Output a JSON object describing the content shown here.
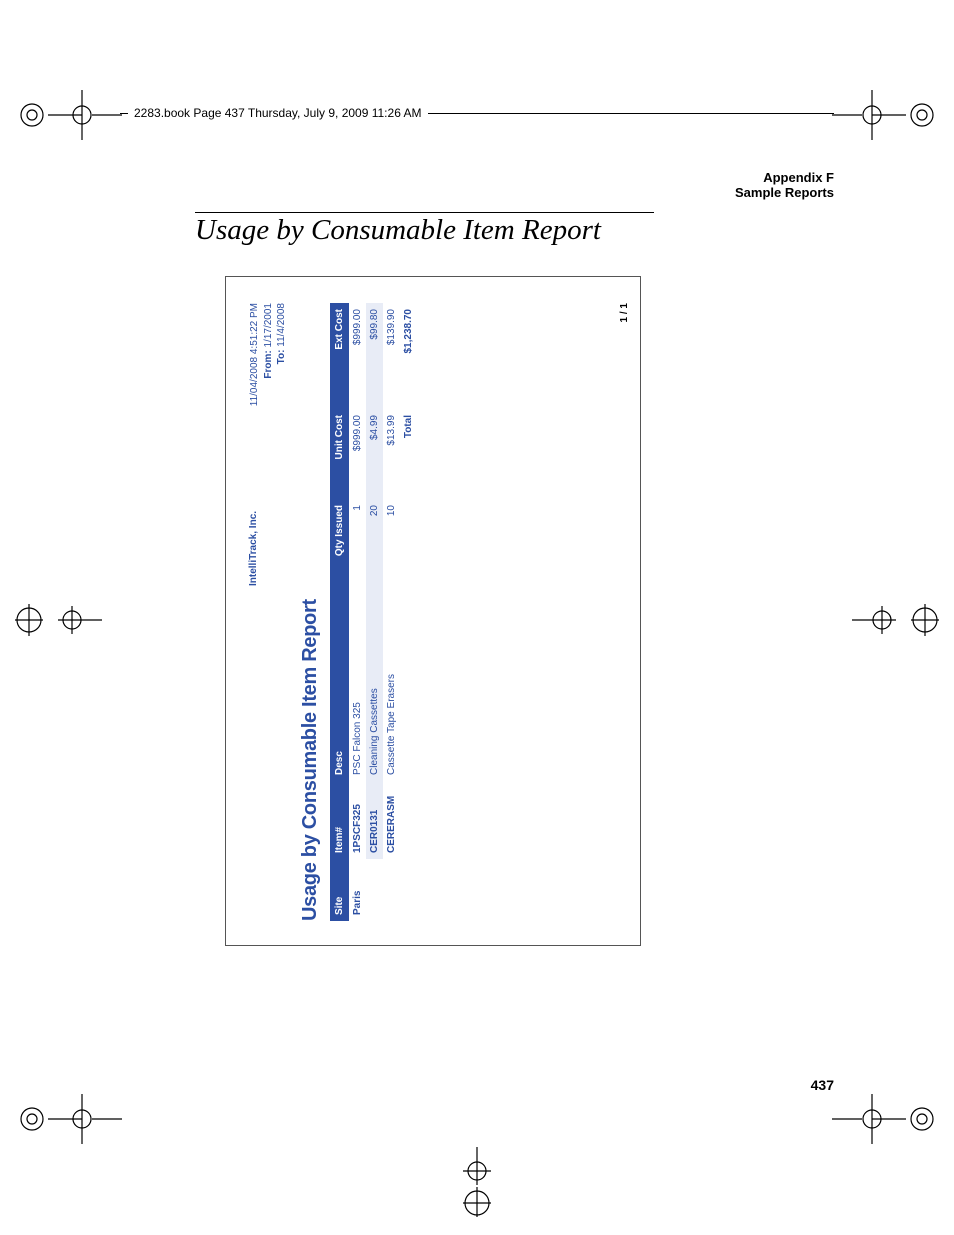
{
  "book_header": "2283.book  Page 437  Thursday, July 9, 2009  11:26 AM",
  "appendix": {
    "line1": "Appendix F",
    "line2": "Sample Reports"
  },
  "section_title": "Usage by Consumable Item Report",
  "page_number": "437",
  "report": {
    "company": "IntelliTrack, Inc.",
    "timestamp": "11/04/2008 4:51:22 PM",
    "from_label": "From:",
    "from_value": "1/17/2001",
    "to_label": "To:",
    "to_value": "11/4/2008",
    "title": "Usage by Consumable Item Report",
    "columns": {
      "site": "Site",
      "item": "Item#",
      "desc": "Desc",
      "qty": "Qty Issued",
      "unit": "Unit Cost",
      "ext": "Ext Cost"
    },
    "site": "Paris",
    "rows": [
      {
        "item": "1PSCF325",
        "desc": "PSC Falcon 325",
        "qty": "1",
        "unit": "$999.00",
        "ext": "$999.00"
      },
      {
        "item": "CER0131",
        "desc": "Cleaning Cassettes",
        "qty": "20",
        "unit": "$4.99",
        "ext": "$99.80"
      },
      {
        "item": "CERERASM",
        "desc": "Cassette Tape Erasers",
        "qty": "10",
        "unit": "$13.99",
        "ext": "$139.90"
      }
    ],
    "total_label": "Total",
    "total_value": "$1,238.70",
    "page_indicator": "1 / 1"
  }
}
